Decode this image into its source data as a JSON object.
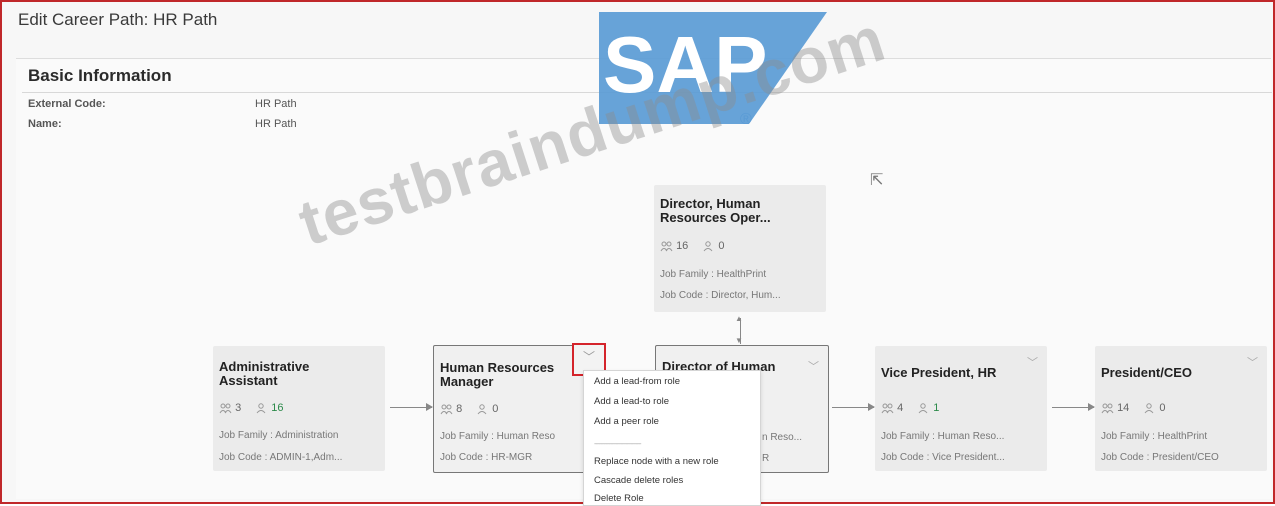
{
  "page": {
    "title": "Edit Career Path: HR Path"
  },
  "basic_info": {
    "section_title": "Basic Information",
    "fields": [
      {
        "label": "External Code:",
        "value": "HR Path"
      },
      {
        "label": "Name:",
        "value": "HR Path"
      }
    ]
  },
  "nodes": {
    "director_ops": {
      "title": "Director, Human Resources Oper...",
      "count_a": "16",
      "count_b": "0",
      "job_family": "Job Family : HealthPrint",
      "job_code": "Job Code : Director, Hum..."
    },
    "admin_assistant": {
      "title": "Administrative Assistant",
      "count_a": "3",
      "count_b": "16",
      "job_family": "Job Family : Administration",
      "job_code": "Job Code : ADMIN-1,Adm..."
    },
    "hr_manager": {
      "title": "Human Resources Manager",
      "count_a": "8",
      "count_b": "0",
      "job_family": "Job Family : Human Reso",
      "job_code": "Job Code : HR-MGR"
    },
    "director_hr": {
      "title": "Director of Human",
      "job_family_tail": "n Reso...",
      "job_code_tail": "R"
    },
    "vp_hr": {
      "title": "Vice President, HR",
      "count_a": "4",
      "count_b": "1",
      "job_family": "Job Family : Human Reso...",
      "job_code": "Job Code : Vice President..."
    },
    "president": {
      "title": "President/CEO",
      "count_a": "14",
      "count_b": "0",
      "job_family": "Job Family : HealthPrint",
      "job_code": "Job Code : President/CEO"
    }
  },
  "context_menu": {
    "items": [
      "Add a lead-from role",
      "Add a lead-to role",
      "Add a peer role",
      "----------------------------",
      "Replace node with a new role",
      "Cascade delete roles",
      "Delete Role"
    ]
  },
  "overlay": {
    "logo_text": "SAP",
    "logo_mark": "®",
    "watermark": "testbraindump.com"
  },
  "colors": {
    "frame": "#c0282a",
    "sap_blue": "#5a9bd5",
    "green_count": "#2c8a4a"
  },
  "icons": {
    "chevron": "chevron-down-icon",
    "group": "people-group-icon",
    "person": "person-icon"
  }
}
